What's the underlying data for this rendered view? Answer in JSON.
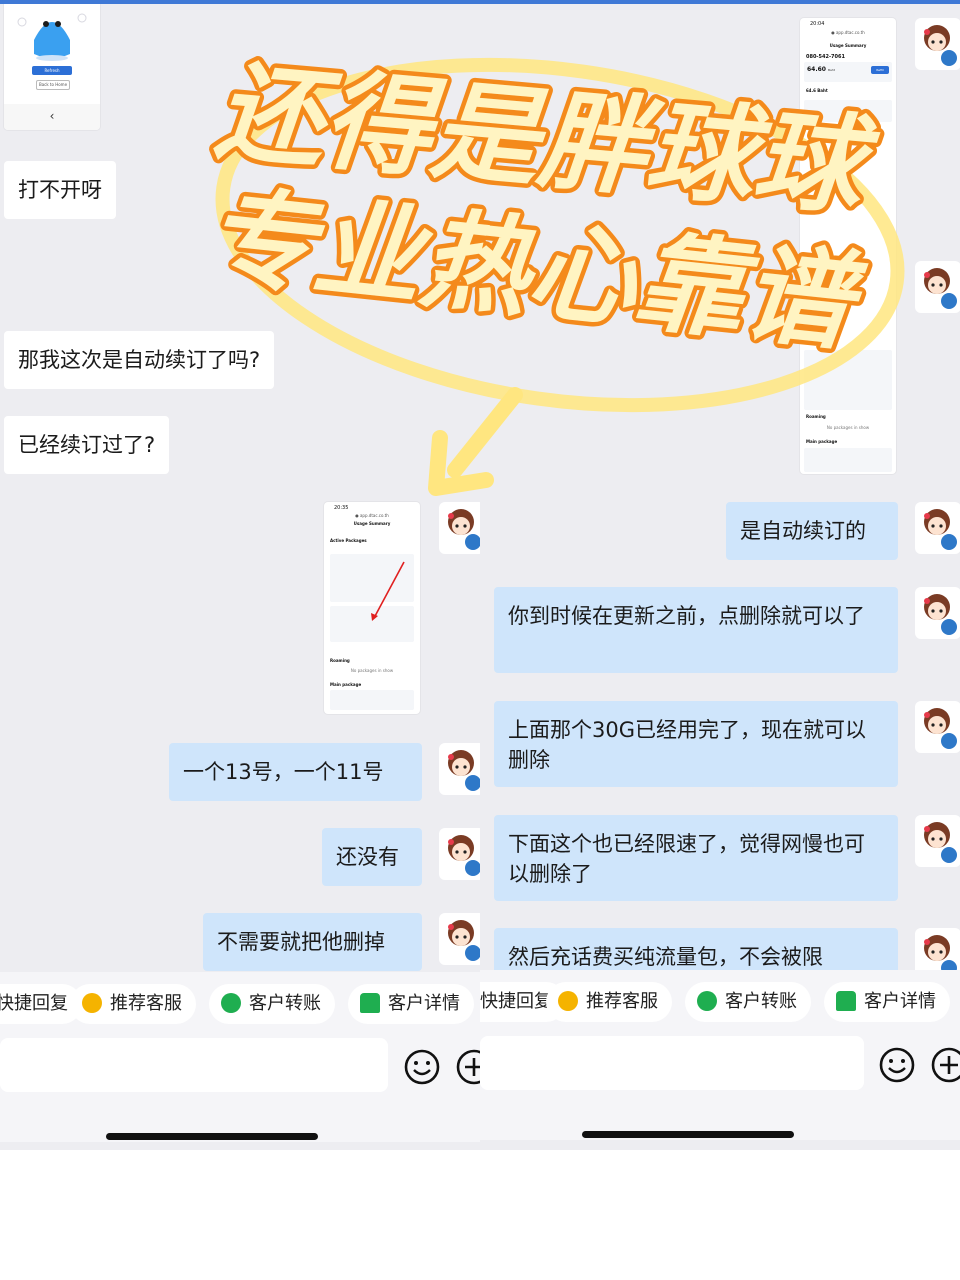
{
  "overlay": {
    "headline_line1": "还得是胖球球",
    "headline_line2": "专业热心靠谱"
  },
  "left": {
    "thumb_top": {
      "button_primary": "Refresh",
      "button_secondary": "Back to Home",
      "nav": "‹"
    },
    "messages": [
      {
        "side": "other",
        "text": "打不开呀"
      },
      {
        "side": "other",
        "text": "那我这次是自动续订了吗?"
      },
      {
        "side": "other",
        "text": "已经续订过了?"
      },
      {
        "side": "mine",
        "text": "一个13号，一个11号"
      },
      {
        "side": "mine",
        "text": "还没有"
      },
      {
        "side": "mine",
        "text": "不需要就把他删掉"
      }
    ],
    "screenshot_mine": {
      "time": "20:35",
      "url": "● app.dtac.co.th",
      "header": "Usage Summary",
      "section_active": "Active Packages",
      "section_roaming": "Roaming",
      "roaming_empty": "No packages in show",
      "section_main": "Main package"
    }
  },
  "right": {
    "screenshot_other": {
      "time": "20:04",
      "url": "● app.dtac.co.th",
      "header": "Usage Summary",
      "phone": "080-542-7061",
      "balance": "64.60",
      "balance_unit": "Baht",
      "refill": "Refill",
      "refill_balance": "64.6 Baht",
      "section_roaming": "Roaming",
      "roaming_empty": "No packages in show",
      "section_main": "Main package"
    },
    "messages": [
      {
        "side": "mine",
        "text": "是自动续订的"
      },
      {
        "side": "mine",
        "text": "你到时候在更新之前，点删除就可以了"
      },
      {
        "side": "mine",
        "text": "上面那个30G已经用完了，现在就可以删除"
      },
      {
        "side": "mine",
        "text": "下面这个也已经限速了，觉得网慢也可以删除了"
      },
      {
        "side": "mine",
        "text": "然后充话费买纯流量包，不会被限"
      }
    ]
  },
  "quick_actions": {
    "items": [
      {
        "label": "快捷回复",
        "icon": "quick-reply-icon"
      },
      {
        "label": "推荐客服",
        "icon": "recommend-icon"
      },
      {
        "label": "客户转账",
        "icon": "transfer-icon"
      },
      {
        "label": "客户详情",
        "icon": "user-detail-icon"
      }
    ],
    "colors": {
      "recommend": "#f5b300",
      "transfer": "#1fae50",
      "user_detail": "#1fae50"
    }
  },
  "colors": {
    "mine_bubble": "#cfe5fb",
    "other_bubble": "#ffffff",
    "background": "#ededf1",
    "overlay_fill": "#fff4c2",
    "overlay_stroke": "#f48a1b"
  }
}
